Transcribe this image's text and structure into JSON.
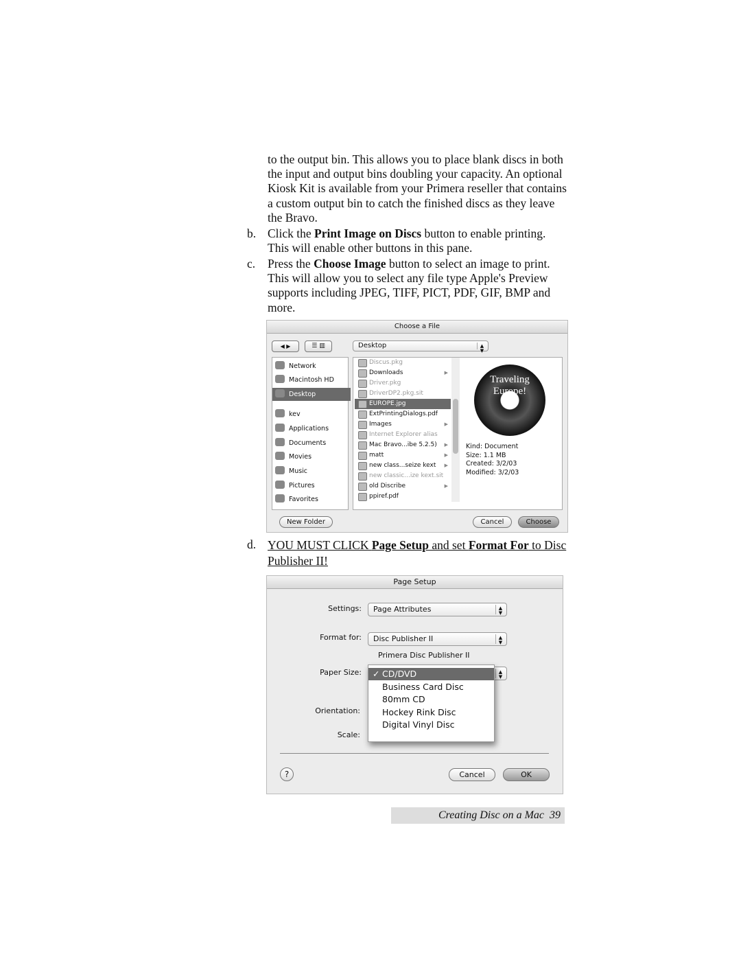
{
  "body": {
    "para1": "to the output bin.  This allows you to place blank discs in both the input and output bins doubling your capacity.  An optional Kiosk Kit is available from your Primera reseller that contains a custom output bin to catch the finished discs as they leave the Bravo.",
    "b": {
      "marker": "b.",
      "pre": "Click the ",
      "bold": "Print Image on Discs",
      "post": " button to enable printing.  This will enable other buttons in this pane."
    },
    "c": {
      "marker": "c.",
      "pre": "Press the ",
      "bold": "Choose Image",
      "post": " button to select an image to print.  This will allow you to select any file type Apple's Preview supports including JPEG, TIFF, PICT, PDF, GIF, BMP and more."
    },
    "d": {
      "marker": "d.",
      "part1": "YOU MUST CLICK ",
      "bold1": "Page Setup",
      "mid": " and set ",
      "bold2": "Format For",
      "part2": " to Disc Publisher II!"
    }
  },
  "file_dialog": {
    "title": "Choose a File",
    "location": "Desktop",
    "sidebar": [
      "Network",
      "Macintosh HD",
      "Desktop",
      "kev",
      "Applications",
      "Documents",
      "Movies",
      "Music",
      "Pictures",
      "Favorites"
    ],
    "sidebar_selected": "Desktop",
    "files": [
      {
        "name": "Discus.pkg",
        "dim": true,
        "folder": false
      },
      {
        "name": "Downloads",
        "dim": false,
        "folder": true
      },
      {
        "name": "Driver.pkg",
        "dim": true,
        "folder": false
      },
      {
        "name": "DriverDP2.pkg.sit",
        "dim": true,
        "folder": false
      },
      {
        "name": "EUROPE.jpg",
        "dim": false,
        "folder": false,
        "selected": true
      },
      {
        "name": "ExtPrintingDialogs.pdf",
        "dim": false,
        "folder": false
      },
      {
        "name": "Images",
        "dim": false,
        "folder": true
      },
      {
        "name": "Internet Explorer alias",
        "dim": true,
        "folder": false
      },
      {
        "name": "Mac Bravo...ibe 5.2.5)",
        "dim": false,
        "folder": true
      },
      {
        "name": "matt",
        "dim": false,
        "folder": true
      },
      {
        "name": "new class...seize kext",
        "dim": false,
        "folder": true
      },
      {
        "name": "new classic...ize kext.sit",
        "dim": true,
        "folder": false
      },
      {
        "name": "old Discribe",
        "dim": false,
        "folder": true
      },
      {
        "name": "ppiref.pdf",
        "dim": false,
        "folder": false
      }
    ],
    "preview": {
      "disc_text": "Traveling Europe!",
      "kind": "Kind: Document",
      "size": "Size: 1.1 MB",
      "created": "Created: 3/2/03",
      "modified": "Modified: 3/2/03"
    },
    "buttons": {
      "new_folder": "New Folder",
      "cancel": "Cancel",
      "choose": "Choose"
    }
  },
  "page_setup": {
    "title": "Page Setup",
    "settings_label": "Settings:",
    "settings_value": "Page Attributes",
    "format_label": "Format for:",
    "format_value": "Disc Publisher II",
    "printer_desc": "Primera Disc Publisher II",
    "paper_label": "Paper Size:",
    "paper_options": [
      "CD/DVD",
      "Business Card Disc",
      "80mm CD",
      "Hockey Rink Disc",
      "Digital Vinyl Disc"
    ],
    "paper_selected": "CD/DVD",
    "orientation_label": "Orientation:",
    "scale_label": "Scale:",
    "buttons": {
      "help": "?",
      "cancel": "Cancel",
      "ok": "OK"
    }
  },
  "footer": {
    "text": "Creating Disc on a Mac",
    "page": "39"
  }
}
